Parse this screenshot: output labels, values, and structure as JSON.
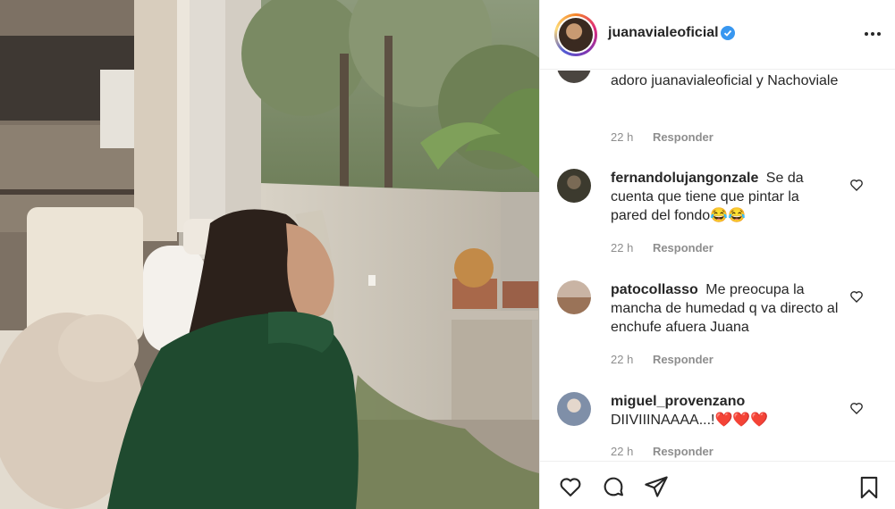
{
  "post": {
    "username": "juanavialeoficial",
    "verified": true,
    "icons": [
      "more-icon",
      "heart-icon",
      "comment-icon",
      "share-icon",
      "bookmark-icon"
    ]
  },
  "comments": [
    {
      "username": "",
      "text": "adoro juanavialeoficial y Nachoviale",
      "time": "22 h",
      "reply": "Responder"
    },
    {
      "username": "fernandolujangonzale",
      "text": "Se da cuenta que tiene que pintar la pared del fondo😂😂",
      "time": "22 h",
      "reply": "Responder"
    },
    {
      "username": "patocollasso",
      "text": "Me preocupa la mancha de humedad q va directo al enchufe afuera Juana",
      "time": "22 h",
      "reply": "Responder"
    },
    {
      "username": "miguel_provenzano",
      "text": "DIIVIIINAAAA...!❤️❤️❤️",
      "time": "22 h",
      "reply": "Responder"
    }
  ],
  "colors": {
    "text": "#262626",
    "muted": "#8e8e8e",
    "verified": "#3897f0",
    "heart": "#ed4956",
    "sweater": "#1f4a2f"
  }
}
